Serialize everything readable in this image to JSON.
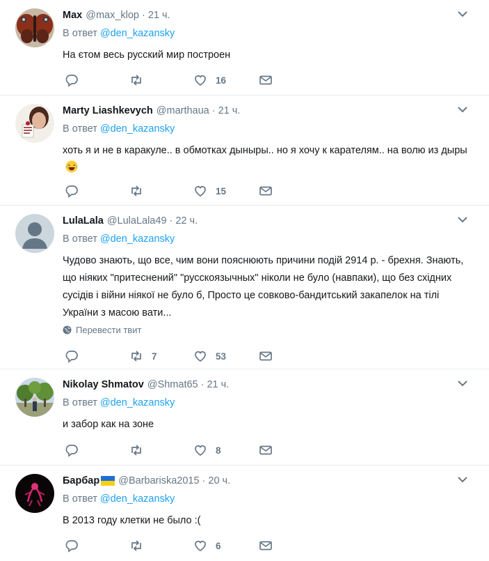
{
  "reply_prefix": "В ответ",
  "tweets": [
    {
      "name": "Max",
      "handle": "@max_klop",
      "time": "21 ч.",
      "reply_to": "@den_kazansky",
      "text": "На єтом весь русский мир построен",
      "retweets": "",
      "likes": "16",
      "avatar": "butterfly"
    },
    {
      "name": "Marty Liashkevych",
      "handle": "@marthaua",
      "time": "21 ч.",
      "reply_to": "@den_kazansky",
      "text": "хоть я и не в каракуле.. в обмотках дыныры.. но я хочу к карателям.. на волю из дыры",
      "emoji": "laughing-tears-emoji",
      "retweets": "",
      "likes": "15",
      "avatar": "woman-portrait"
    },
    {
      "name": "LulaLala",
      "handle": "@LulaLala49",
      "time": "22 ч.",
      "reply_to": "@den_kazansky",
      "text": "Чудово знають, що все, чим вони пояснюють причини подій 2914 р. - брехня. Знають, що ніяких \"притеснений\" \"русскоязычных\" ніколи не було (навпаки), що без східних сусідів і війни ніякої не було б, Просто це совково-бандитський закапелок на тілі України з масою вати...",
      "translate": "Перевести твит",
      "retweets": "7",
      "likes": "53",
      "avatar": "default-person"
    },
    {
      "name": "Nikolay Shmatov",
      "handle": "@Shmat65",
      "time": "21 ч.",
      "reply_to": "@den_kazansky",
      "text": "и забор как на зоне",
      "retweets": "",
      "likes": "8",
      "avatar": "park-trees"
    },
    {
      "name": "Барбар",
      "handle": "@Barbariska2015",
      "time": "20 ч.",
      "reply_to": "@den_kazansky",
      "text": "В 2013 году клетки не было :(",
      "retweets": "",
      "likes": "6",
      "avatar": "dark-neon",
      "flag": "ukraine-flag"
    }
  ],
  "colors": {
    "text": "#14171a",
    "secondary": "#657786",
    "link": "#1da1f2",
    "divider": "#e6ecf0"
  }
}
